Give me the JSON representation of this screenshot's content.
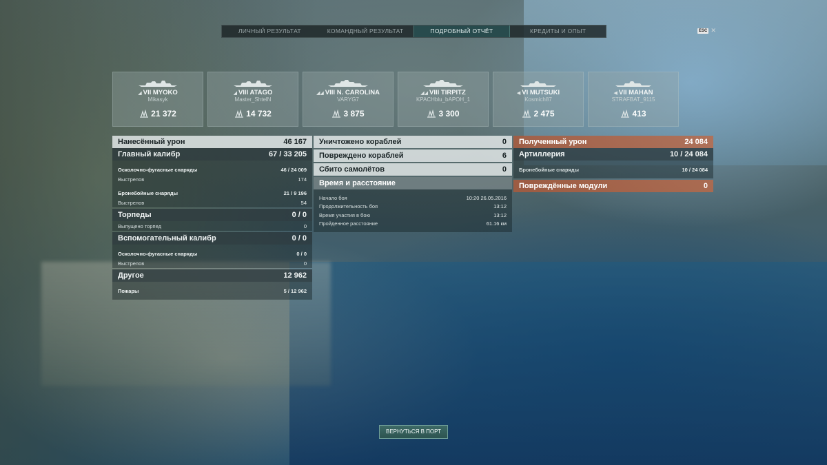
{
  "tabs": [
    {
      "label": "ЛИЧНЫЙ РЕЗУЛЬТАТ"
    },
    {
      "label": "КОМАНДНЫЙ РЕЗУЛЬТАТ"
    },
    {
      "label": "ПОДРОБНЫЙ ОТЧЁТ",
      "active": true
    },
    {
      "label": "КРЕДИТЫ И ОПЫТ"
    }
  ],
  "esc": {
    "key": "ESC",
    "close": "✕"
  },
  "ships": [
    {
      "tier": "VII",
      "name": "MYOKO",
      "player": "Mikasyk",
      "damage": "21 372",
      "class_icon": "◢"
    },
    {
      "tier": "VIII",
      "name": "ATAGO",
      "player": "Master_ShtelN",
      "damage": "14 732",
      "class_icon": "◢"
    },
    {
      "tier": "VIII",
      "name": "N. CAROLINA",
      "player": "VARYG7",
      "damage": "3 875",
      "class_icon": "◢◢"
    },
    {
      "tier": "VIII",
      "name": "TIRPITZ",
      "player": "KPACHblu_bAPOH_1",
      "damage": "3 300",
      "class_icon": "◢◢"
    },
    {
      "tier": "VI",
      "name": "MUTSUKI",
      "player": "Kosmich87",
      "damage": "2 475",
      "class_icon": "◀"
    },
    {
      "tier": "VII",
      "name": "MAHAN",
      "player": "STRAFBAT_9115",
      "damage": "413",
      "class_icon": "◀"
    }
  ],
  "left": {
    "dealt": {
      "label": "Нанесённый урон",
      "value": "46 167"
    },
    "main": {
      "label": "Главный калибр",
      "value": "67 / 33 205"
    },
    "he": {
      "label": "Осколочно-фугасные снаряды",
      "value": "46 / 24 009"
    },
    "he_shots": {
      "label": "Выстрелов",
      "value": "174"
    },
    "ap": {
      "label": "Бронебойные снаряды",
      "value": "21 / 9 196"
    },
    "ap_shots": {
      "label": "Выстрелов",
      "value": "54"
    },
    "torp": {
      "label": "Торпеды",
      "value": "0 / 0"
    },
    "torp_fired": {
      "label": "Выпущено торпед",
      "value": "0"
    },
    "secondary": {
      "label": "Вспомогательный калибр",
      "value": "0 / 0"
    },
    "sec_he": {
      "label": "Осколочно-фугасные снаряды",
      "value": "0 / 0"
    },
    "sec_shots": {
      "label": "Выстрелов",
      "value": "0"
    },
    "other": {
      "label": "Другое",
      "value": "12 962"
    },
    "fires": {
      "label": "Пожары",
      "value": "5 / 12 962"
    }
  },
  "middle": {
    "destroyed": {
      "label": "Уничтожено кораблей",
      "value": "0"
    },
    "damaged": {
      "label": "Повреждено кораблей",
      "value": "6"
    },
    "planes": {
      "label": "Сбито самолётов",
      "value": "0"
    },
    "time_dist": {
      "label": "Время и расстояние"
    },
    "start": {
      "label": "Начало боя",
      "value": "10:20  26.05.2016"
    },
    "duration": {
      "label": "Продолжительность боя",
      "value": "13:12"
    },
    "participation": {
      "label": "Время участия в бою",
      "value": "13:12"
    },
    "distance": {
      "label": "Пройденное расстояние",
      "value": "61.16 км"
    }
  },
  "right": {
    "received": {
      "label": "Полученный урон",
      "value": "24 084"
    },
    "artillery": {
      "label": "Артиллерия",
      "value": "10 / 24 084"
    },
    "ap": {
      "label": "Бронебойные снаряды",
      "value": "10 / 24 084"
    },
    "modules": {
      "label": "Повреждённые модули",
      "value": "0"
    }
  },
  "return_button": "ВЕРНУТЬСЯ В ПОРТ"
}
